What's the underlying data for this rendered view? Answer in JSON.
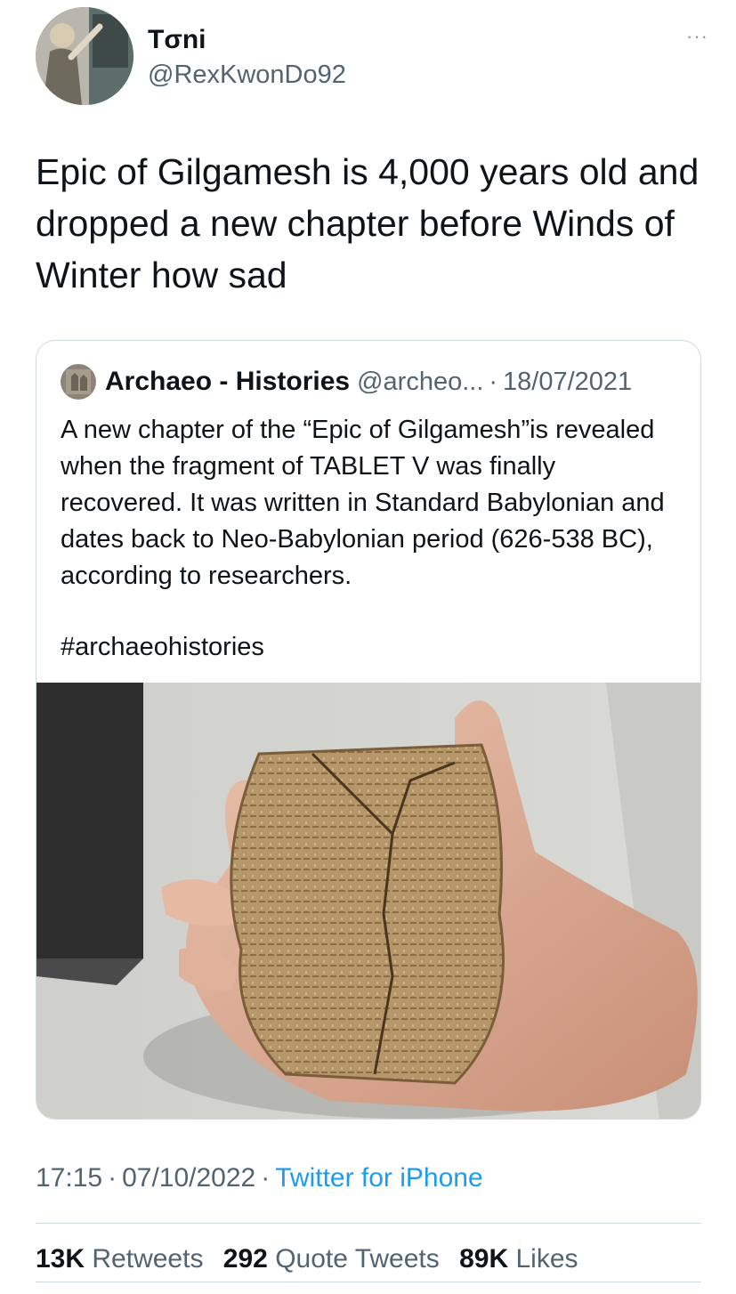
{
  "author": {
    "display_name": "Tσni",
    "handle": "@RexKwonDo92",
    "avatar_icon": "profile-photo",
    "more_icon": "more-options-icon",
    "more_glyph": "···"
  },
  "tweet": {
    "text": "Epic of Gilgamesh is 4,000 years old and dropped a new chapter before Winds of Winter how sad"
  },
  "quoted_tweet": {
    "display_name": "Archaeo - Histories",
    "handle": "@archeo...",
    "separator": "·",
    "date": "18/07/2021",
    "text": "A new chapter of the “Epic of Gilgamesh”is revealed when the fragment of TABLET V was finally recovered. It was written in Standard Babylonian and dates back to Neo-Babylonian period (626-538 BC), according to researchers.",
    "hashtag": "#archaeohistories",
    "image": "clay-tablet-photo"
  },
  "meta": {
    "time": "17:15",
    "separator": "·",
    "date": "07/10/2022",
    "source": "Twitter for iPhone"
  },
  "stats": {
    "retweets_count": "13K",
    "retweets_label": "Retweets",
    "quotes_count": "292",
    "quotes_label": "Quote Tweets",
    "likes_count": "89K",
    "likes_label": "Likes"
  },
  "colors": {
    "text": "#0f1419",
    "secondary": "#536471",
    "link": "#1d9bf0",
    "border": "#cfd9de"
  }
}
